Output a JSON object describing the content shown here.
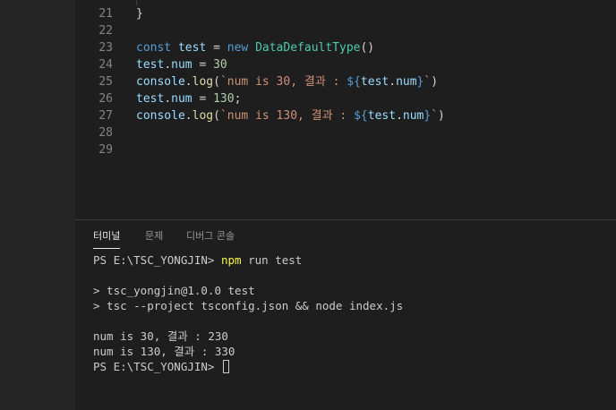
{
  "editor": {
    "lines": [
      {
        "no": "21",
        "parts": [
          [
            "}",
            "pun"
          ]
        ]
      },
      {
        "no": "22",
        "parts": []
      },
      {
        "no": "23",
        "parts": [
          [
            "const",
            "kw"
          ],
          [
            " ",
            "pun"
          ],
          [
            "test",
            "var"
          ],
          [
            " = ",
            "pun"
          ],
          [
            "new",
            "kw"
          ],
          [
            " ",
            "pun"
          ],
          [
            "DataDefaultType",
            "cls"
          ],
          [
            "()",
            "pun"
          ]
        ]
      },
      {
        "no": "24",
        "parts": [
          [
            "test",
            "var"
          ],
          [
            ".",
            "pun"
          ],
          [
            "num",
            "var"
          ],
          [
            " = ",
            "pun"
          ],
          [
            "30",
            "num"
          ]
        ]
      },
      {
        "no": "25",
        "parts": [
          [
            "console",
            "var"
          ],
          [
            ".",
            "pun"
          ],
          [
            "log",
            "fn"
          ],
          [
            "(",
            "pun"
          ],
          [
            "`num is 30, 결과 : ",
            "str"
          ],
          [
            "${",
            "kw"
          ],
          [
            "test",
            "var"
          ],
          [
            ".",
            "pun"
          ],
          [
            "num",
            "var"
          ],
          [
            "}",
            "kw"
          ],
          [
            "`",
            "str"
          ],
          [
            ")",
            "pun"
          ]
        ]
      },
      {
        "no": "26",
        "parts": [
          [
            "test",
            "var"
          ],
          [
            ".",
            "pun"
          ],
          [
            "num",
            "var"
          ],
          [
            " = ",
            "pun"
          ],
          [
            "130",
            "num"
          ],
          [
            ";",
            "pun"
          ]
        ]
      },
      {
        "no": "27",
        "parts": [
          [
            "console",
            "var"
          ],
          [
            ".",
            "pun"
          ],
          [
            "log",
            "fn"
          ],
          [
            "(",
            "pun"
          ],
          [
            "`num is 130, 결과 : ",
            "str"
          ],
          [
            "${",
            "kw"
          ],
          [
            "test",
            "var"
          ],
          [
            ".",
            "pun"
          ],
          [
            "num",
            "var"
          ],
          [
            "}",
            "kw"
          ],
          [
            "`",
            "str"
          ],
          [
            ")",
            "pun"
          ]
        ]
      },
      {
        "no": "28",
        "parts": []
      },
      {
        "no": "29",
        "parts": []
      }
    ]
  },
  "panel": {
    "tabs": [
      {
        "label": "터미널",
        "active": true
      },
      {
        "label": "문제",
        "active": false
      },
      {
        "label": "디버그 콘솔",
        "active": false
      }
    ]
  },
  "terminal": {
    "prompt1": "PS E:\\TSC_YONGJIN>",
    "cmd_npm": "npm",
    "cmd_rest": "run test",
    "line_a": "> tsc_yongjin@1.0.0 test",
    "line_b": "> tsc --project tsconfig.json && node index.js",
    "out1": "num is 30, 결과 : 230",
    "out2": "num is 130, 결과 : 330",
    "prompt2": "PS E:\\TSC_YONGJIN>"
  }
}
